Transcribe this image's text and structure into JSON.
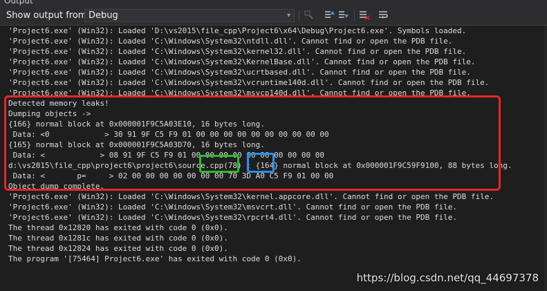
{
  "window": {
    "title": "Output"
  },
  "toolbar": {
    "show_output_label": "Show output from:",
    "source_selected": "Debug",
    "icons": [
      "find-message-icon",
      "previous-message-icon",
      "next-message-icon",
      "clear-all-icon",
      "word-wrap-icon"
    ]
  },
  "output": {
    "lines": [
      "'Project6.exe' (Win32): Loaded 'D:\\vs2015\\file_cpp\\Project6\\x64\\Debug\\Project6.exe'. Symbols loaded.",
      "'Project6.exe' (Win32): Loaded 'C:\\Windows\\System32\\ntdll.dll'. Cannot find or open the PDB file.",
      "'Project6.exe' (Win32): Loaded 'C:\\Windows\\System32\\kernel32.dll'. Cannot find or open the PDB file.",
      "'Project6.exe' (Win32): Loaded 'C:\\Windows\\System32\\KernelBase.dll'. Cannot find or open the PDB file.",
      "'Project6.exe' (Win32): Loaded 'C:\\Windows\\System32\\ucrtbased.dll'. Cannot find or open the PDB file.",
      "'Project6.exe' (Win32): Loaded 'C:\\Windows\\System32\\vcruntime140d.dll'. Cannot find or open the PDB file.",
      "'Project6.exe' (Win32): Loaded 'C:\\Windows\\System32\\msvcp140d.dll'. Cannot find or open the PDB file.",
      "Detected memory leaks!",
      "Dumping objects ->",
      "{166} normal block at 0x000001F9C5A03E10, 16 bytes long.",
      " Data: <0            > 30 91 9F C5 F9 01 00 00 00 00 00 00 00 00 00 00",
      "{165} normal block at 0x000001F9C5A03D70, 16 bytes long.",
      " Data: <            > 08 91 9F C5 F9 01 00 00 00 00 00 00 00 00 00 00",
      "d:\\vs2015\\file_cpp\\project6\\project6\\source.cpp(78) : {164} normal block at 0x000001F9C59F9100, 88 bytes long.",
      " Data: <       p=     > 02 00 00 00 00 00 00 00 70 3D A0 C5 F9 01 00 00",
      "Object dump complete.",
      "'Project6.exe' (Win32): Loaded 'C:\\Windows\\System32\\kernel.appcore.dll'. Cannot find or open the PDB file.",
      "'Project6.exe' (Win32): Loaded 'C:\\Windows\\System32\\msvcrt.dll'. Cannot find or open the PDB file.",
      "'Project6.exe' (Win32): Loaded 'C:\\Windows\\System32\\rpcrt4.dll'. Cannot find or open the PDB file.",
      "The thread 0x12820 has exited with code 0 (0x0).",
      "The thread 0x1281c has exited with code 0 (0x0).",
      "The thread 0x12824 has exited with code 0 (0x0).",
      "The program '[75464] Project6.exe' has exited with code 0 (0x0)."
    ]
  },
  "annotations": {
    "red_color": "#e8262a",
    "green_color": "#2fba2f",
    "blue_color": "#2a8ef2"
  },
  "watermark": {
    "text": "https://blog.csdn.net/qq_44697378"
  }
}
